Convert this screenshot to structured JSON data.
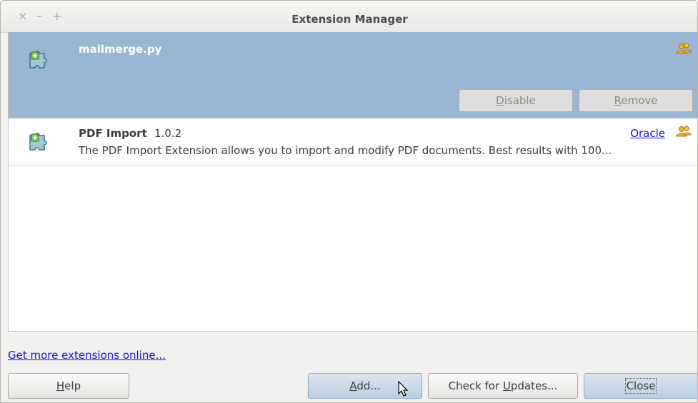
{
  "window": {
    "title": "Extension Manager",
    "controls": {
      "close": "×",
      "minimize": "–",
      "maximize": "+"
    }
  },
  "extensions": [
    {
      "name": "mailmerge.py",
      "version": "",
      "description": "",
      "publisher": "",
      "selected": true,
      "icon": "puzzle-piece-icon",
      "shared_icon": "shared-users-icon",
      "buttons": {
        "disable_prefix": "",
        "disable_mnemonic": "D",
        "disable_rest": "isable",
        "remove_prefix": "",
        "remove_mnemonic": "R",
        "remove_rest": "emove"
      }
    },
    {
      "name": "PDF Import",
      "version": "1.0.2",
      "description": "The PDF Import Extension allows you to import and modify PDF documents. Best results with 100...",
      "publisher": "Oracle",
      "selected": false,
      "icon": "puzzle-piece-icon",
      "shared_icon": "shared-users-icon"
    }
  ],
  "links": {
    "get_more": "Get more extensions online..."
  },
  "buttons": {
    "help_mnemonic": "H",
    "help_rest": "elp",
    "add_mnemonic": "A",
    "add_rest": "dd...",
    "updates_prefix": "Check for ",
    "updates_mnemonic": "U",
    "updates_rest": "pdates...",
    "close": "Close"
  },
  "colors": {
    "selection": "#9ab6d3",
    "link": "#1515c8",
    "window_bg": "#f2f1f0"
  }
}
